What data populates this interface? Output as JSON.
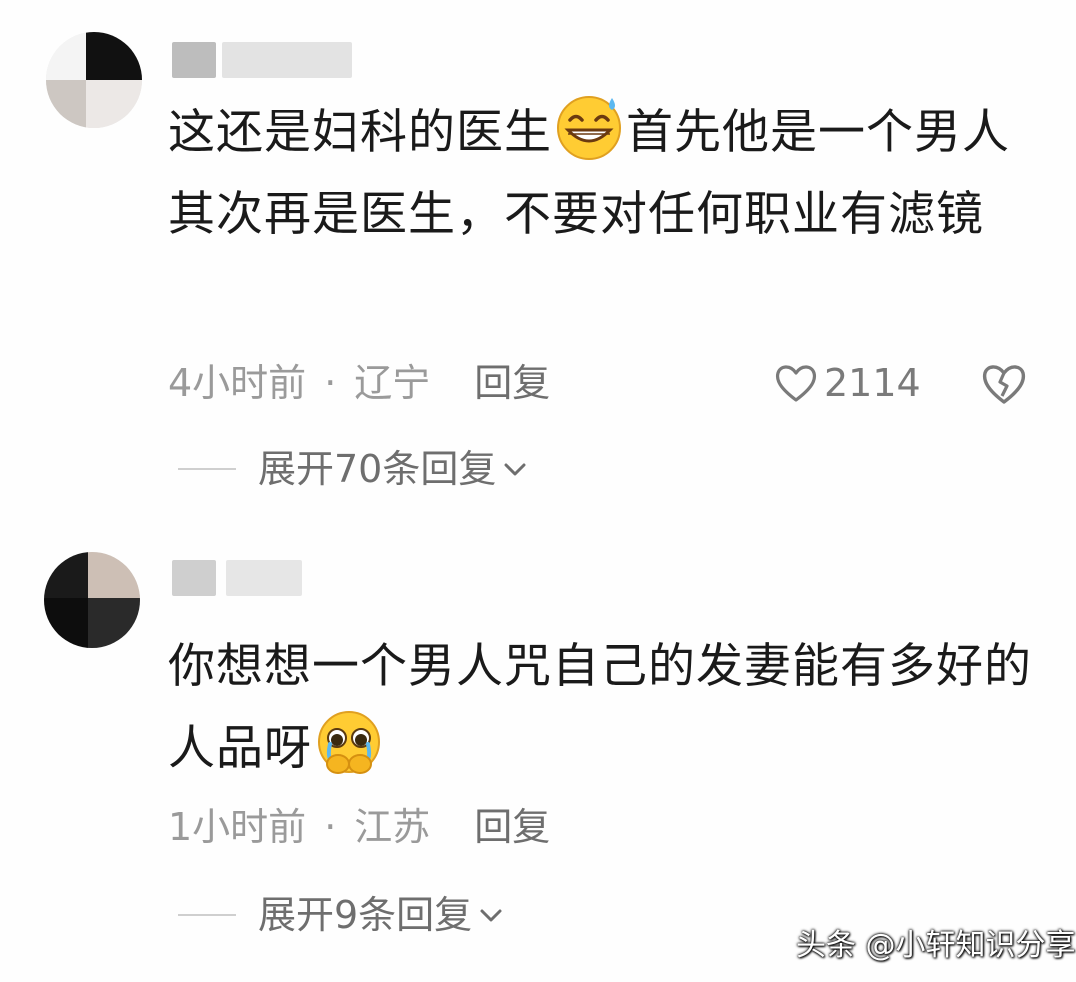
{
  "comments": [
    {
      "text_before": "这还是妇科的医生",
      "emoji_name": "sweat-smile-emoji",
      "text_after": "首先他是一个男人其次再是医生，不要对任何职业有滤镜",
      "time": "4小时前",
      "separator": "·",
      "location": "辽宁",
      "reply_label": "回复",
      "likes": "2114",
      "expand_label": "展开70条回复"
    },
    {
      "text_before": "你想想一个男人咒自己的发妻能有多好的人品呀",
      "emoji_name": "pleading-face-emoji",
      "text_after": "",
      "time": "1小时前",
      "separator": "·",
      "location": "江苏",
      "reply_label": "回复",
      "expand_label": "展开9条回复"
    }
  ],
  "watermark": "头条 @小轩知识分享",
  "colors": {
    "text": "#1a1a1a",
    "meta": "#9a9a9a",
    "action": "#6e6e6e",
    "emoji_yellow": "#ffcc33"
  }
}
